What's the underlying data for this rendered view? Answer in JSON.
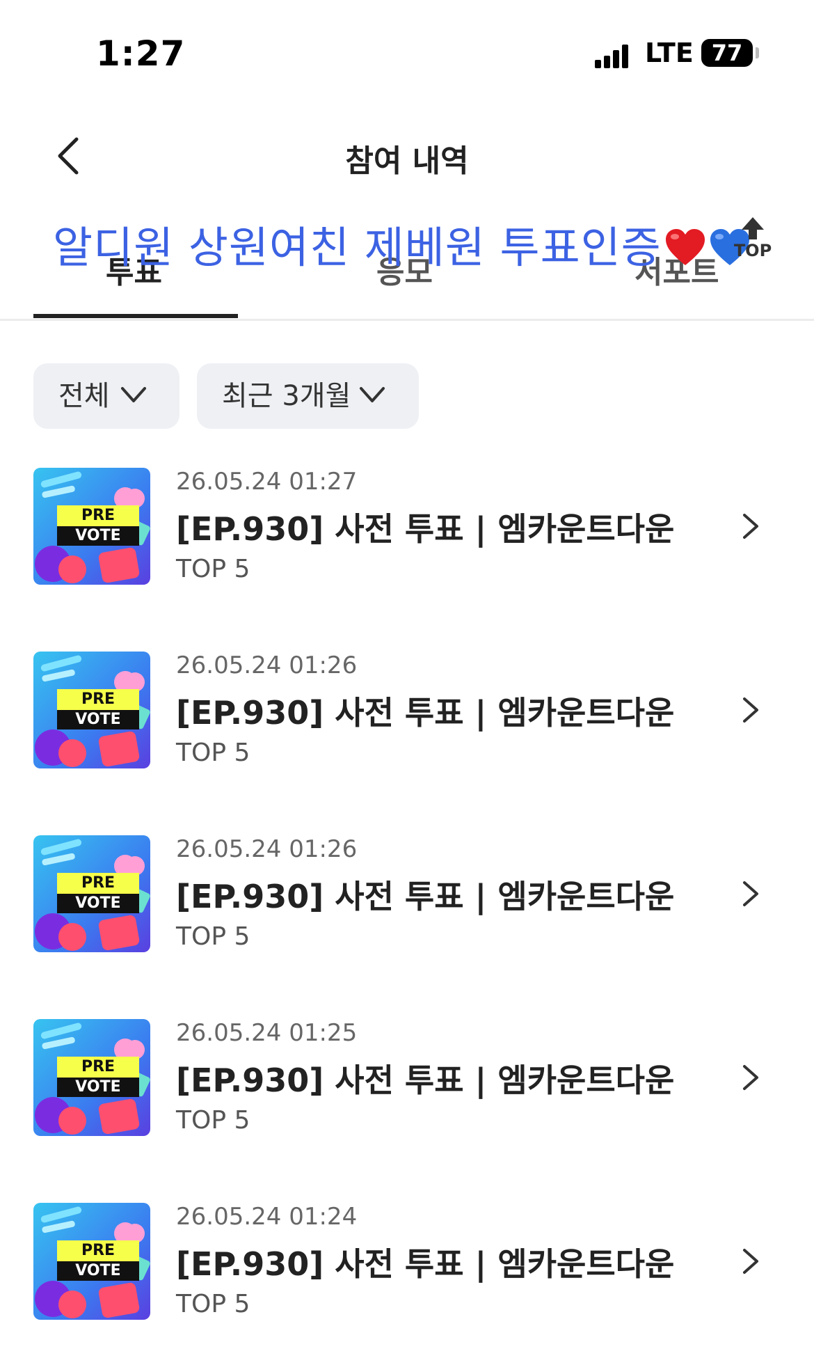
{
  "status_bar": {
    "time": "1:27",
    "network": "LTE",
    "battery": "77"
  },
  "header": {
    "title": "참여 내역"
  },
  "tabs": [
    {
      "label": "투표",
      "active": true
    },
    {
      "label": "응모",
      "active": false
    },
    {
      "label": "서포트",
      "active": false
    }
  ],
  "overlay": {
    "text": "알디원 상원여친 제베원 투표인증"
  },
  "top_button": {
    "label": "TOP"
  },
  "filters": {
    "category": "전체",
    "period": "최근 3개월"
  },
  "thumbnail": {
    "line1": "PRE",
    "line2": "VOTE"
  },
  "items": [
    {
      "date": "26.05.24 01:27",
      "title": "[EP.930] 사전 투표 | 엠카운트다운",
      "sub": "TOP 5"
    },
    {
      "date": "26.05.24 01:26",
      "title": "[EP.930] 사전 투표 | 엠카운트다운",
      "sub": "TOP 5"
    },
    {
      "date": "26.05.24 01:26",
      "title": "[EP.930] 사전 투표 | 엠카운트다운",
      "sub": "TOP 5"
    },
    {
      "date": "26.05.24 01:25",
      "title": "[EP.930] 사전 투표 | 엠카운트다운",
      "sub": "TOP 5"
    },
    {
      "date": "26.05.24 01:24",
      "title": "[EP.930] 사전 투표 | 엠카운트다운",
      "sub": "TOP 5"
    }
  ]
}
